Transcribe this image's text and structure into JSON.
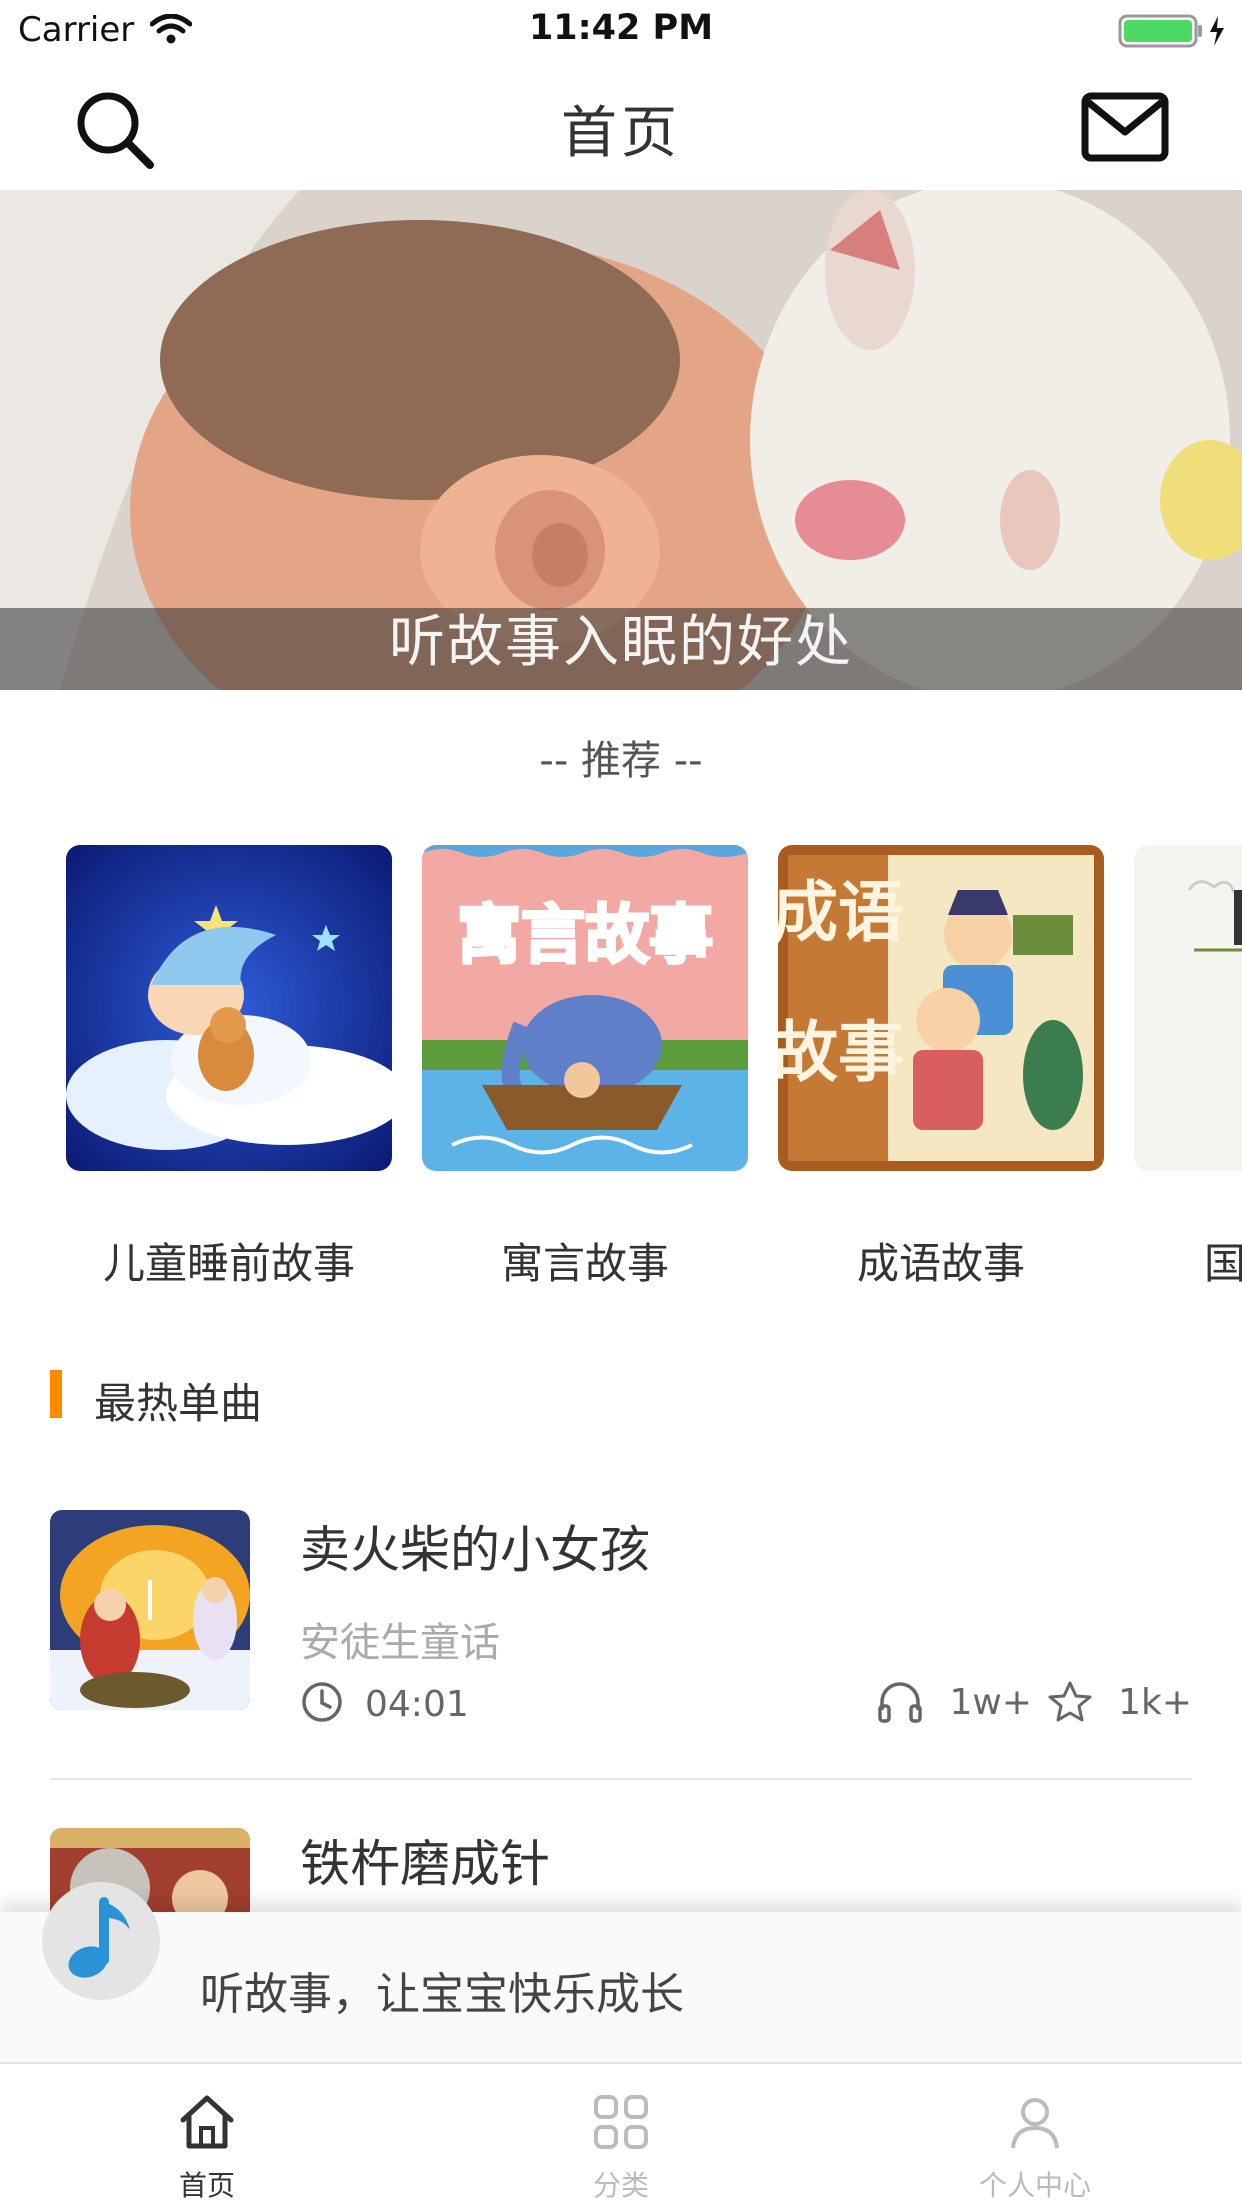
{
  "status_bar": {
    "carrier": "Carrier",
    "time": "11:42 PM"
  },
  "nav": {
    "title": "首页",
    "search_icon": "search-icon",
    "mail_icon": "mail-icon"
  },
  "banner": {
    "caption": "听故事入眠的好处"
  },
  "recommend": {
    "title": "-- 推荐 --",
    "items": [
      {
        "label": "儿童睡前故事"
      },
      {
        "label": "寓言故事",
        "cover_text": "寓言故事"
      },
      {
        "label": "成语故事",
        "cover_text_1": "成语",
        "cover_text_2": "故事"
      },
      {
        "label": "国"
      }
    ]
  },
  "hot": {
    "title": "最热单曲",
    "accent_color": "#ff8a00",
    "songs": [
      {
        "title": "卖火柴的小女孩",
        "author": "安徒生童话",
        "duration": "04:01",
        "plays": "1w+",
        "favs": "1k+"
      },
      {
        "title": "铁杵磨成针"
      }
    ]
  },
  "player": {
    "text": "听故事，让宝宝快乐成长",
    "icon": "music-note-icon"
  },
  "tabs": [
    {
      "label": "首页",
      "icon": "home-icon",
      "active": true
    },
    {
      "label": "分类",
      "icon": "grid-icon",
      "active": false
    },
    {
      "label": "个人中心",
      "icon": "person-icon",
      "active": false
    }
  ]
}
